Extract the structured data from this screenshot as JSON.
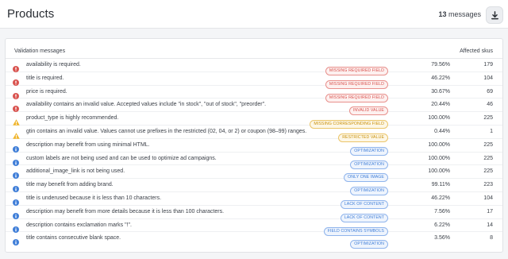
{
  "header": {
    "title": "Products",
    "count": "13",
    "count_suffix": "messages"
  },
  "table": {
    "col_messages": "Validation messages",
    "col_skus": "Affected skus",
    "rows": [
      {
        "severity": "error",
        "text": "availability is required.",
        "badge": "MISSING REQUIRED FIELD",
        "badge_color": "red",
        "pct": "79.56%",
        "skus": "179"
      },
      {
        "severity": "error",
        "text": "title is required.",
        "badge": "MISSING REQUIRED FIELD",
        "badge_color": "red",
        "pct": "46.22%",
        "skus": "104"
      },
      {
        "severity": "error",
        "text": "price is required.",
        "badge": "MISSING REQUIRED FIELD",
        "badge_color": "red",
        "pct": "30.67%",
        "skus": "69"
      },
      {
        "severity": "error",
        "text": "availability contains an invalid value. Accepted values include \"in stock\", \"out of stock\", \"preorder\".",
        "badge": "INVALID VALUE",
        "badge_color": "red",
        "pct": "20.44%",
        "skus": "46"
      },
      {
        "severity": "warning",
        "text": "product_type is highly recommended.",
        "badge": "MISSING CORRESPONDING FIELD",
        "badge_color": "yellow",
        "pct": "100.00%",
        "skus": "225"
      },
      {
        "severity": "warning",
        "text": "gtin contains an invalid value. Values cannot use prefixes in the restricted (02, 04, or 2) or coupon (98–99) ranges.",
        "badge": "RESTRICTED VALUE",
        "badge_color": "yellow",
        "pct": "0.44%",
        "skus": "1"
      },
      {
        "severity": "info",
        "text": "description may benefit from using minimal HTML.",
        "badge": "OPTIMIZATION",
        "badge_color": "blue",
        "pct": "100.00%",
        "skus": "225"
      },
      {
        "severity": "info",
        "text": "custom labels are not being used and can be used to optimize ad campaigns.",
        "badge": "OPTIMIZATION",
        "badge_color": "blue",
        "pct": "100.00%",
        "skus": "225"
      },
      {
        "severity": "info",
        "text": "additional_image_link is not being used.",
        "badge": "ONLY ONE IMAGE",
        "badge_color": "blue",
        "pct": "100.00%",
        "skus": "225"
      },
      {
        "severity": "info",
        "text": "title may benefit from adding brand.",
        "badge": "OPTIMIZATION",
        "badge_color": "blue",
        "pct": "99.11%",
        "skus": "223"
      },
      {
        "severity": "info",
        "text": "title is underused because it is less than 10 characters.",
        "badge": "LACK OF CONTENT",
        "badge_color": "blue",
        "pct": "46.22%",
        "skus": "104"
      },
      {
        "severity": "info",
        "text": "description may benefit from more details because it is less than 100 characters.",
        "badge": "LACK OF CONTENT",
        "badge_color": "blue",
        "pct": "7.56%",
        "skus": "17"
      },
      {
        "severity": "info",
        "text": "description contains exclamation marks \"!\".",
        "badge": "FIELD CONTAINS SYMBOLS",
        "badge_color": "blue",
        "pct": "6.22%",
        "skus": "14"
      },
      {
        "severity": "info",
        "text": "title contains consecutive blank space.",
        "badge": "OPTIMIZATION",
        "badge_color": "blue",
        "pct": "3.56%",
        "skus": "8"
      }
    ]
  },
  "colors": {
    "error": "#d9534f",
    "warning": "#f0b429",
    "info": "#3f7ed8"
  },
  "icons": {
    "error": "error-circle-icon",
    "warning": "warning-triangle-icon",
    "info": "info-circle-icon",
    "download": "download-icon"
  }
}
